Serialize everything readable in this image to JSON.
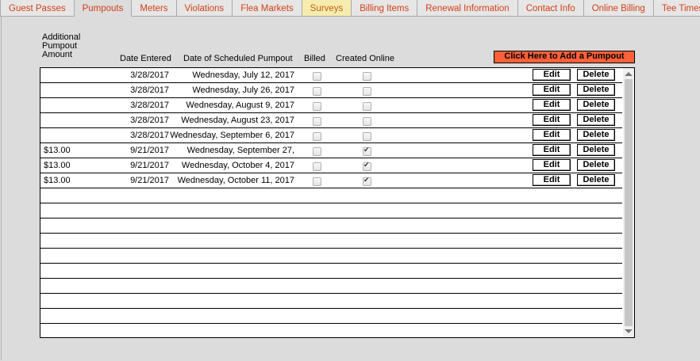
{
  "tabs": [
    {
      "label": "Guest Passes",
      "active": false
    },
    {
      "label": "Pumpouts",
      "active": true
    },
    {
      "label": "Meters",
      "active": false
    },
    {
      "label": "Violations",
      "active": false
    },
    {
      "label": "Flea Markets",
      "active": false
    },
    {
      "label": "Surveys",
      "active": false,
      "highlight": true
    },
    {
      "label": "Billing Items",
      "active": false
    },
    {
      "label": "Renewal Information",
      "active": false
    },
    {
      "label": "Contact Info",
      "active": false
    },
    {
      "label": "Online Billing",
      "active": false
    },
    {
      "label": "Tee Times",
      "active": false
    }
  ],
  "headers": {
    "amount": "Additional Pumpout Amount",
    "date_entered": "Date Entered",
    "scheduled": "Date of Scheduled Pumpout",
    "billed": "Billed",
    "created_online": "Created Online"
  },
  "add_button": "Click Here to Add a Pumpout",
  "row_buttons": {
    "edit": "Edit",
    "delete": "Delete"
  },
  "colors": {
    "tab_text": "#d2401a",
    "add_button_bg": "#ff6138",
    "highlight_tab": "#f7ecb0"
  },
  "rows": [
    {
      "amount": "",
      "date_entered": "3/28/2017",
      "scheduled": "Wednesday, July 12, 2017",
      "billed": false,
      "online": false
    },
    {
      "amount": "",
      "date_entered": "3/28/2017",
      "scheduled": "Wednesday, July 26, 2017",
      "billed": false,
      "online": false
    },
    {
      "amount": "",
      "date_entered": "3/28/2017",
      "scheduled": "Wednesday, August 9, 2017",
      "billed": false,
      "online": false
    },
    {
      "amount": "",
      "date_entered": "3/28/2017",
      "scheduled": "Wednesday, August 23, 2017",
      "billed": false,
      "online": false
    },
    {
      "amount": "",
      "date_entered": "3/28/2017",
      "scheduled": "Wednesday, September 6, 2017",
      "billed": false,
      "online": false
    },
    {
      "amount": "$13.00",
      "date_entered": "9/21/2017",
      "scheduled": "Wednesday, September 27,",
      "billed": false,
      "online": true
    },
    {
      "amount": "$13.00",
      "date_entered": "9/21/2017",
      "scheduled": "Wednesday, October 4, 2017",
      "billed": false,
      "online": true
    },
    {
      "amount": "$13.00",
      "date_entered": "9/21/2017",
      "scheduled": "Wednesday, October 11, 2017",
      "billed": false,
      "online": true
    }
  ]
}
